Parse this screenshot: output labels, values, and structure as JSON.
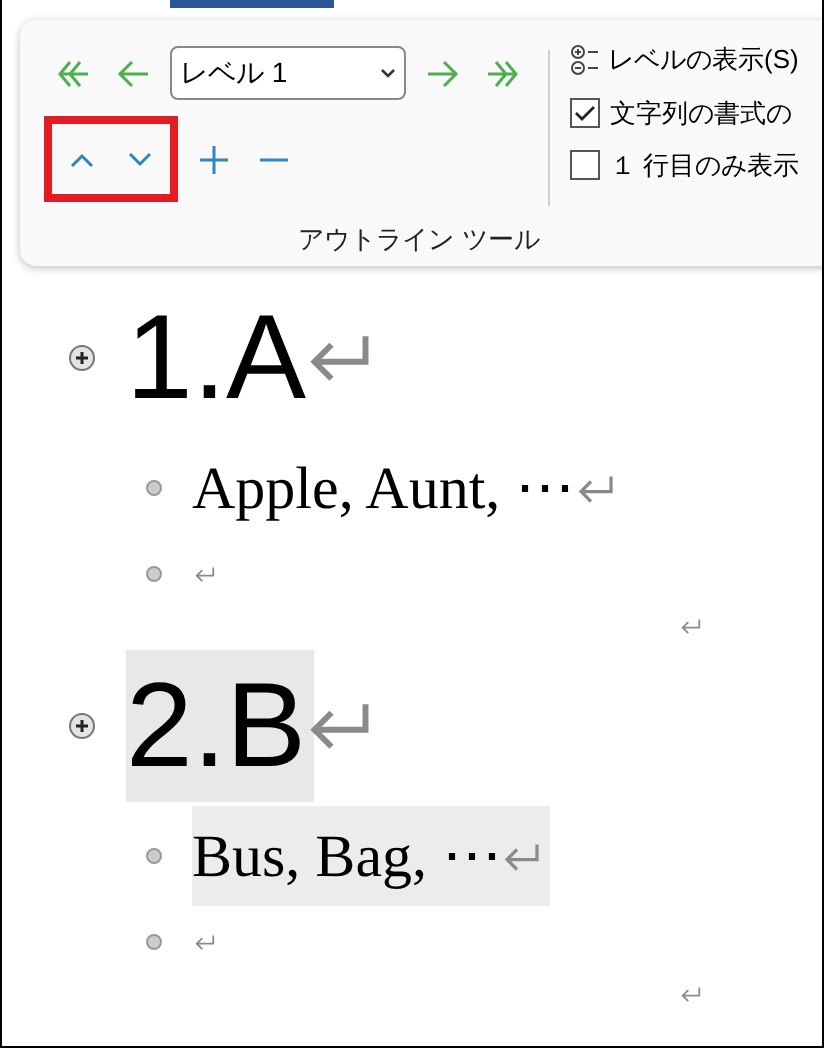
{
  "ribbon": {
    "level_dropdown": {
      "value": "レベル 1"
    },
    "show_level": {
      "label": "レベルの表示(S)"
    },
    "checkboxes": [
      {
        "label": "文字列の書式の",
        "checked": true
      },
      {
        "label": "１ 行目のみ表示",
        "checked": false
      }
    ],
    "group_label": "アウトライン ツール"
  },
  "outline": [
    {
      "heading": "1.A",
      "selected": false,
      "children": [
        {
          "kind": "text",
          "text": "Apple, Aunt, ⋯",
          "selected": false
        },
        {
          "kind": "empty"
        }
      ]
    },
    {
      "heading": "2.B",
      "selected": true,
      "children": [
        {
          "kind": "text",
          "text": "Bus, Bag, ⋯",
          "selected": true
        },
        {
          "kind": "empty"
        }
      ]
    }
  ]
}
